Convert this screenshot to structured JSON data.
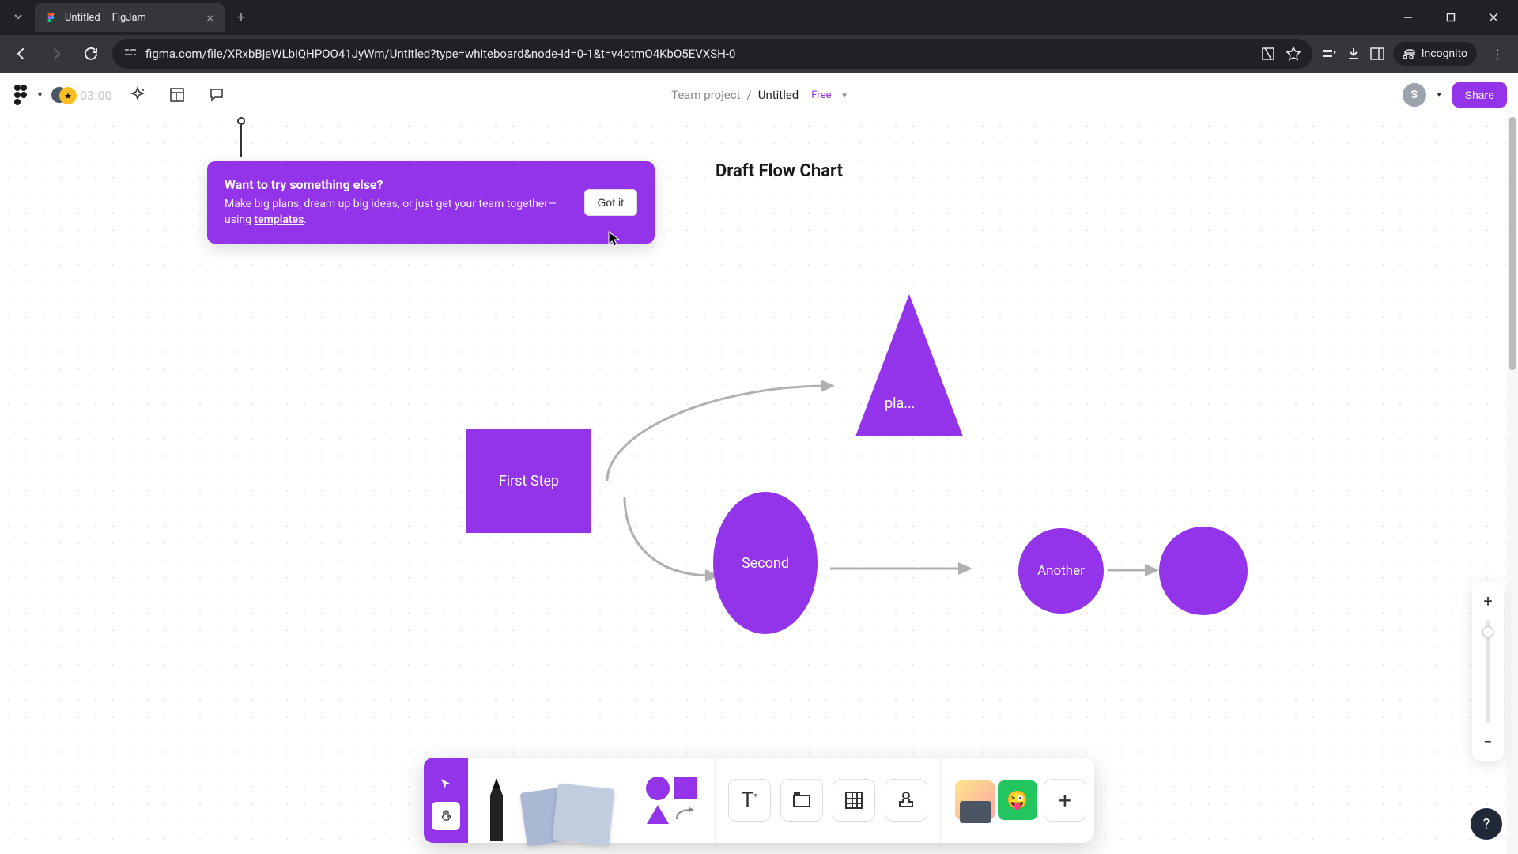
{
  "browser": {
    "tab_title": "Untitled – FigJam",
    "url": "figma.com/file/XRxbBjeWLbiQHPOO41JyWm/Untitled?type=whiteboard&node-id=0-1&t=v4otmO4KbO5EVXSH-0",
    "incognito_label": "Incognito"
  },
  "header": {
    "timer": "03:00",
    "team": "Team project",
    "file": "Untitled",
    "plan": "Free",
    "user_initial": "S",
    "share_label": "Share"
  },
  "tooltip": {
    "title": "Want to try something else?",
    "body_prefix": "Make big plans, dream up big ideas, or just get your team together—using ",
    "body_link": "templates",
    "body_suffix": ".",
    "button": "Got it"
  },
  "canvas": {
    "title": "Draft Flow Chart",
    "shapes": {
      "rect": "First Step",
      "triangle": "pla...",
      "ellipse": "Second",
      "circle1": "Another",
      "circle2": ""
    }
  },
  "toolbar": {
    "text_btn": "T",
    "plus": "+"
  },
  "help": "?"
}
